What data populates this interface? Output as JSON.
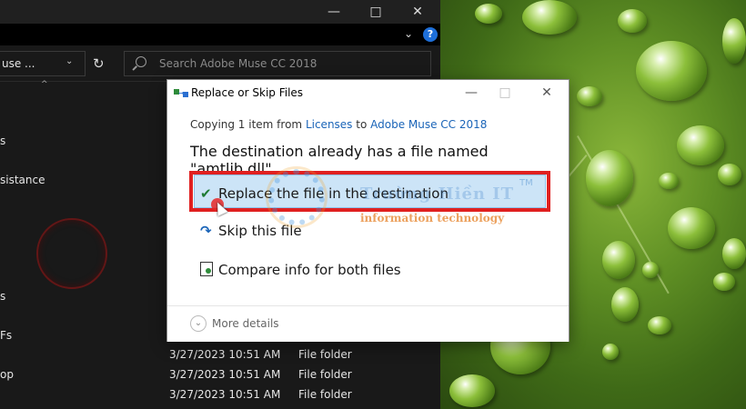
{
  "explorer": {
    "address_fragment": "use ...",
    "search_placeholder": "Search Adobe Muse CC 2018",
    "nav_fragments": [
      "s",
      "sistance",
      "s",
      "Fs",
      "op"
    ],
    "rows": [
      {
        "date": "3/27/2023 10:51 AM",
        "type": "File folder"
      },
      {
        "date": "3/27/2023 10:51 AM",
        "type": "File folder"
      },
      {
        "date": "3/27/2023 10:51 AM",
        "type": "File folder"
      }
    ]
  },
  "dialog": {
    "title": "Replace or Skip Files",
    "copying_prefix": "Copying 1 item from ",
    "source": "Licenses",
    "copying_mid": " to ",
    "target": "Adobe Muse CC 2018",
    "destination_message": "The destination already has a file named \"amtlib.dll\"",
    "options": {
      "replace": "Replace the file in the destination",
      "skip": "Skip this file",
      "compare": "Compare info for both files"
    },
    "more_details": "More details"
  },
  "watermark": {
    "text": "Trường Hiền IT",
    "tm": "TM",
    "subtitle": "information technology"
  },
  "colors": {
    "highlight_border": "#e02020",
    "selection_fill": "#cce4f7",
    "link": "#1a64b8",
    "check": "#1e7b34"
  }
}
